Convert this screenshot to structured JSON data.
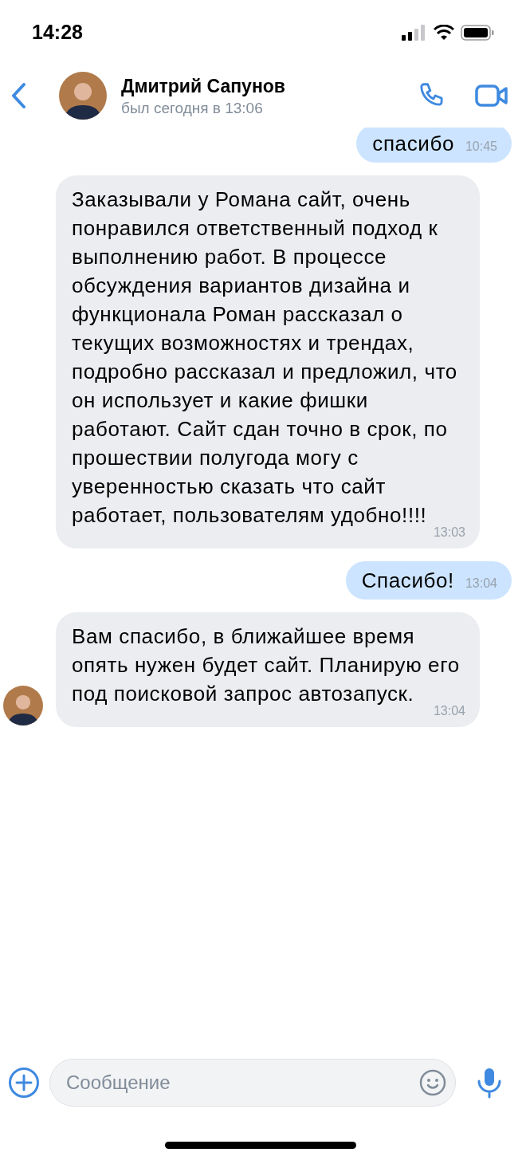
{
  "status_bar": {
    "time": "14:28"
  },
  "header": {
    "name": "Дмитрий Сапунов",
    "last_seen": "был сегодня в 13:06"
  },
  "messages": [
    {
      "kind": "outgoing",
      "text": "спасибо",
      "time": "10:45"
    },
    {
      "kind": "incoming",
      "text": "Заказывали у Романа сайт, очень понравился ответственный подход к выполнению работ. В процессе обсуждения вариантов дизайна и функционала Роман рассказал о текущих возможностях и трендах, подробно рассказал и предложил, что он использует и какие фишки работают. Сайт сдан точно в срок, по прошествии полугода могу с уверенностью сказать что сайт работает, пользователям удобно!!!!",
      "time": "13:03",
      "show_avatar": false
    },
    {
      "kind": "outgoing",
      "text": "Спасибо!",
      "time": "13:04"
    },
    {
      "kind": "incoming",
      "text": "Вам спасибо, в ближайшее время опять нужен будет сайт. Планирую его под поисковой запрос автозапуск.",
      "time": "13:04",
      "show_avatar": true
    }
  ],
  "composer": {
    "placeholder": "Сообщение"
  }
}
